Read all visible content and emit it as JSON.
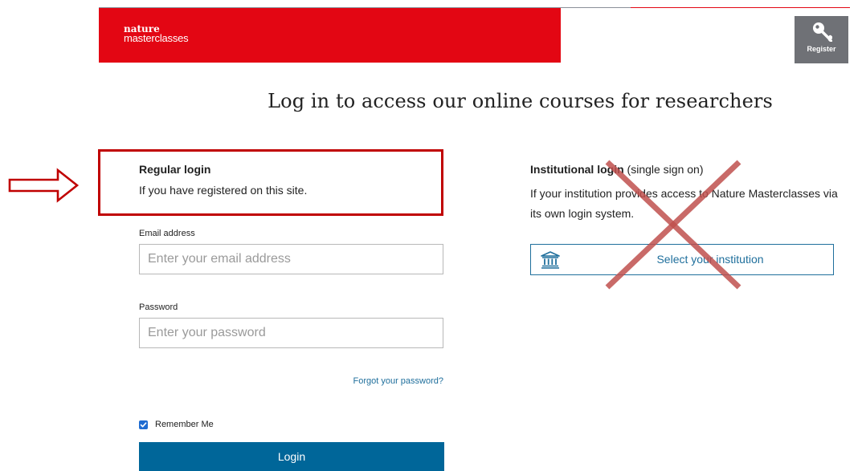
{
  "header": {
    "logo_line1": "nature",
    "logo_line2": "masterclasses",
    "register_label": "Register",
    "brand_color": "#e30613"
  },
  "page": {
    "title": "Log in to access our online courses for researchers"
  },
  "regular_login": {
    "title": "Regular login",
    "description": "If you have registered on this site.",
    "email_label": "Email address",
    "email_placeholder": "Enter your email address",
    "password_label": "Password",
    "password_placeholder": "Enter your password",
    "forgot_label": "Forgot your password?",
    "remember_label": "Remember Me",
    "remember_checked": true,
    "login_label": "Login"
  },
  "institutional_login": {
    "title_bold": "Institutional login",
    "title_suffix": " (single sign on)",
    "description": "If your institution provides access to Nature Masterclasses via its own login system.",
    "select_label": "Select your institution"
  },
  "annotations": {
    "arrow_color": "#c00000",
    "highlight_color": "#c00000",
    "cross_color": "#c0504d",
    "icons": [
      "arrow-right-icon",
      "key-icon",
      "bank-icon",
      "checkmark-icon",
      "cross-out-icon"
    ]
  }
}
